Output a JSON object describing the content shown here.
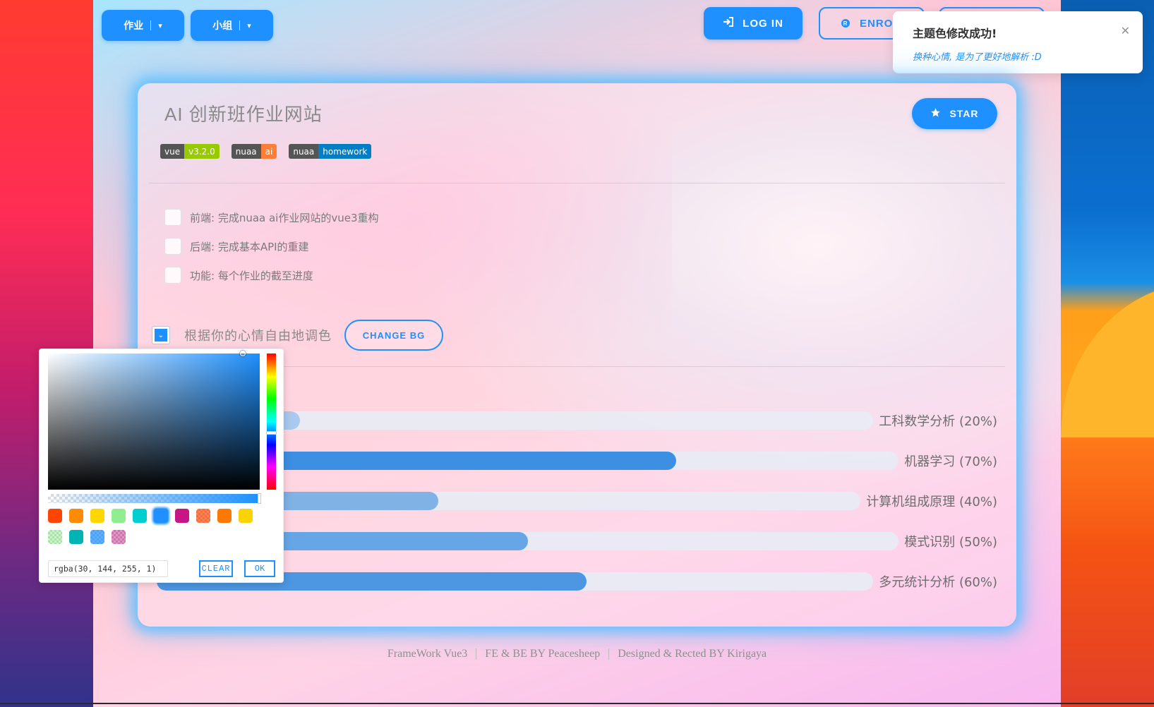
{
  "nav": {
    "homework_dropdown": "作业",
    "group_dropdown": "小组",
    "login_label": "LOG IN",
    "enroll_label": "ENROL",
    "enroll_icon_glyph": "R"
  },
  "toast": {
    "title": "主题色修改成功!",
    "message": "换种心情, 是为了更好地解析 :D",
    "close_glyph": "✕"
  },
  "card": {
    "title": "AI 创新班作业网站",
    "star_label": "STAR",
    "badges": [
      {
        "left": "vue",
        "right": "v3.2.0",
        "color": "#97ca00"
      },
      {
        "left": "nuaa",
        "right": "ai",
        "color": "#fe7d37"
      },
      {
        "left": "nuaa",
        "right": "homework",
        "color": "#007ec6"
      }
    ],
    "tasks": [
      {
        "label": "前端: 完成nuaa ai作业网站的vue3重构",
        "checked": false
      },
      {
        "label": "后端: 完成基本API的重建",
        "checked": false
      },
      {
        "label": "功能: 每个作业的截至进度",
        "checked": false
      }
    ],
    "color_label": "根据你的心情自由地调色",
    "change_bg_label": "CHANGE BG",
    "courses": [
      {
        "label": "工科数学分析 (20%)",
        "percent": 20,
        "color": "#a9c9ee"
      },
      {
        "label": "机器学习 (70%)",
        "percent": 70,
        "color": "#3d8fe3"
      },
      {
        "label": "计算机组成原理 (40%)",
        "percent": 40,
        "color": "#80b2e6"
      },
      {
        "label": "模式识别 (50%)",
        "percent": 50,
        "color": "#66a6e6"
      },
      {
        "label": "多元统计分析 (60%)",
        "percent": 60,
        "color": "#4d96e2"
      }
    ]
  },
  "colorPicker": {
    "value": "rgba(30, 144, 255, 1)",
    "clear_label": "CLEAR",
    "ok_label": "OK",
    "current_color": "#1e90ff",
    "presets": [
      {
        "color": "#ff4500",
        "checker": false,
        "selected": false
      },
      {
        "color": "#ff8c00",
        "checker": false,
        "selected": false
      },
      {
        "color": "#ffd700",
        "checker": false,
        "selected": false
      },
      {
        "color": "#90ee90",
        "checker": false,
        "selected": false
      },
      {
        "color": "#00ced1",
        "checker": false,
        "selected": false
      },
      {
        "color": "#1e90ff",
        "checker": false,
        "selected": true
      },
      {
        "color": "#c71585",
        "checker": false,
        "selected": false
      },
      {
        "color": "rgba(255, 69, 0, 0.68)",
        "checker": true,
        "selected": false
      },
      {
        "color": "#ff7800",
        "checker": false,
        "selected": false
      },
      {
        "color": "#fad400",
        "checker": false,
        "selected": false
      },
      {
        "color": "rgba(144, 240, 144, 0.5)",
        "checker": true,
        "selected": false
      },
      {
        "color": "#00b4b4",
        "checker": false,
        "selected": false
      },
      {
        "color": "rgba(31, 147, 255, 0.73)",
        "checker": true,
        "selected": false
      },
      {
        "color": "rgba(199, 21, 133, 0.46)",
        "checker": true,
        "selected": false
      }
    ]
  },
  "footer": {
    "items": [
      "FrameWork Vue3",
      "FE & BE BY Peacesheep",
      "Designed & Rected BY Kirigaya"
    ]
  },
  "theme": {
    "accent": "#1e90ff"
  }
}
